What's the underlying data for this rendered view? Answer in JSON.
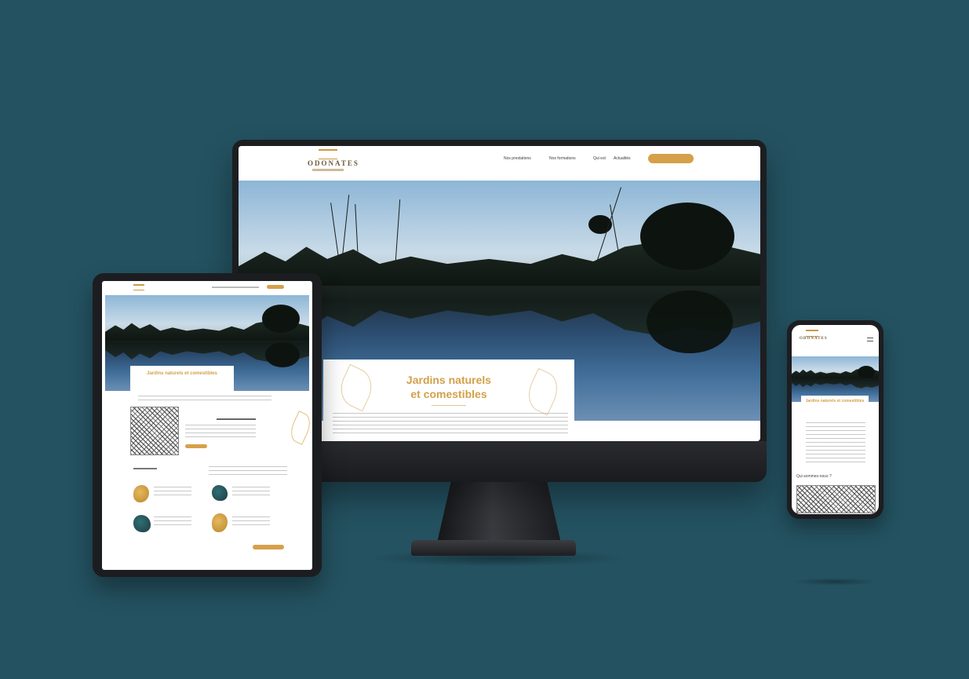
{
  "theme": {
    "background": "#245261",
    "accent": "#d6a04a",
    "dark_frame": "#1d1e21"
  },
  "brand": {
    "logo": "ODONATES"
  },
  "desktop": {
    "nav": {
      "items": [
        "Nos prestations",
        "Nos formations",
        "Qui est",
        "Actualités"
      ],
      "cta": ""
    },
    "hero": {
      "title_line1": "Jardins naturels",
      "title_line2": "et comestibles"
    }
  },
  "tablet": {
    "hero": {
      "title": "Jardins naturels et comestibles"
    }
  },
  "phone": {
    "hero": {
      "title": "Jardins naturels et comestibles"
    },
    "section_title": "Qui sommes-nous ?"
  }
}
